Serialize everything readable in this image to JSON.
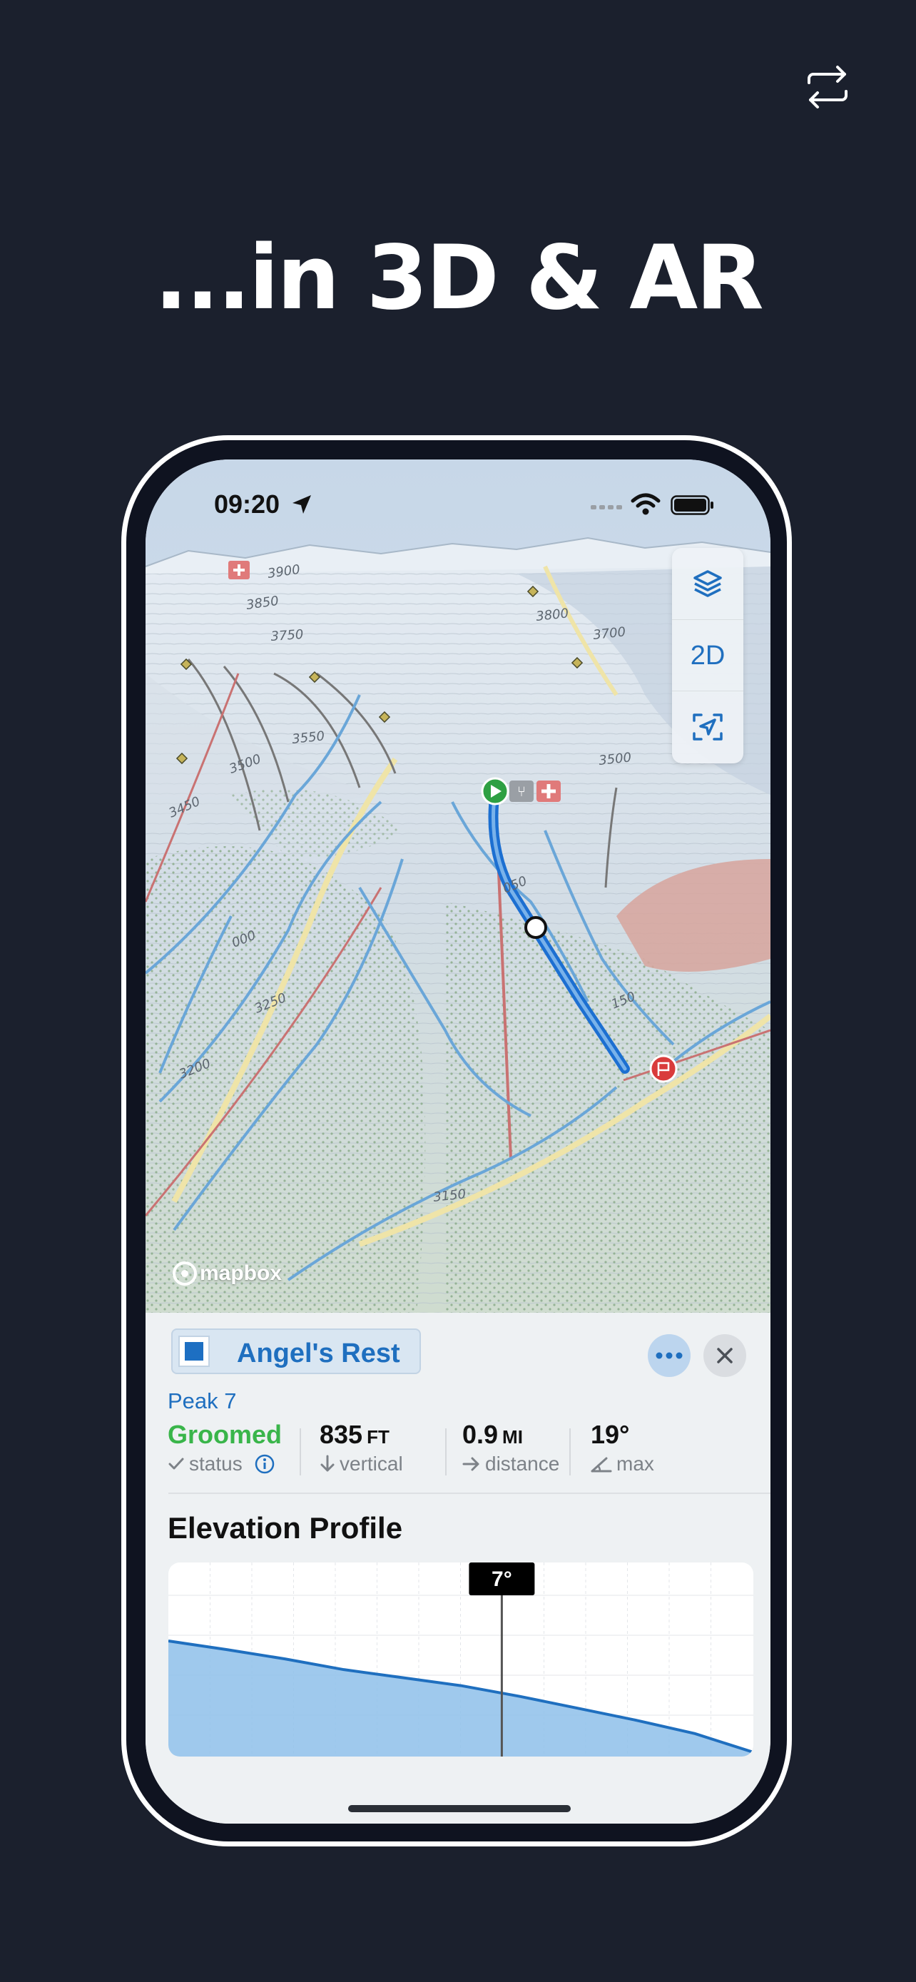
{
  "header": {
    "headline": "...in 3D & AR",
    "swap_icon": "swap-arrows-icon"
  },
  "status_bar": {
    "time": "09:20",
    "icons": [
      "location-arrow-icon",
      "signal-icon",
      "wifi-icon",
      "battery-icon"
    ]
  },
  "map": {
    "controls": [
      {
        "icon": "layers-icon"
      },
      {
        "label": "2D"
      },
      {
        "icon": "locate-icon"
      }
    ],
    "attribution": "mapbox",
    "contour_labels": [
      "3900",
      "3850",
      "3750",
      "3800",
      "3700",
      "3550",
      "3500",
      "3450",
      "3500",
      "3250",
      "3200",
      "3150",
      "000",
      "150",
      "050"
    ],
    "colors": {
      "route": "#1c6fd1",
      "route_start": "#2ea043",
      "route_end": "#d93b3b",
      "lift": "#c86a6a"
    }
  },
  "run": {
    "name": "Angel's Rest",
    "color": "#1d6fc2",
    "area": "Peak 7",
    "stats": [
      {
        "value": "Groomed",
        "unit": "",
        "label": "status",
        "icon": "check-icon",
        "value_color": "#39b54a",
        "info_icon": "info-icon"
      },
      {
        "value": "835",
        "unit": "FT",
        "label": "vertical",
        "icon": "arrow-down-icon",
        "value_color": "#111111"
      },
      {
        "value": "0.9",
        "unit": "MI",
        "label": "distance",
        "icon": "arrow-right-icon",
        "value_color": "#111111"
      },
      {
        "value": "19°",
        "unit": "",
        "label": "max",
        "icon": "angle-icon",
        "value_color": "#111111"
      }
    ]
  },
  "elevation_profile": {
    "title": "Elevation Profile",
    "marker_label": "7°"
  },
  "chart_data": {
    "type": "area",
    "title": "Elevation Profile",
    "x": [
      0,
      0.1,
      0.2,
      0.3,
      0.4,
      0.5,
      0.6,
      0.7,
      0.8,
      0.9,
      1.0
    ],
    "values": [
      835,
      770,
      700,
      620,
      560,
      500,
      420,
      330,
      240,
      140,
      0
    ],
    "marker": {
      "x": 0.57,
      "label": "7°"
    },
    "grid": true,
    "color": "#1f6fbf"
  }
}
